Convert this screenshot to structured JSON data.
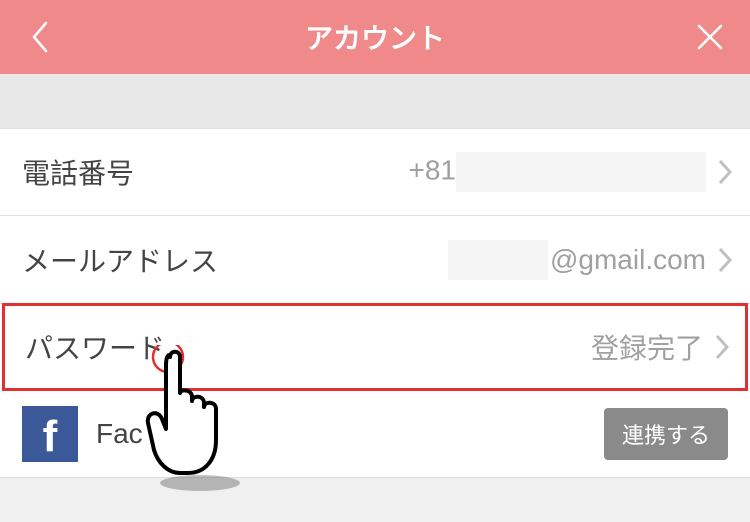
{
  "header": {
    "title": "アカウント"
  },
  "rows": {
    "phone": {
      "label": "電話番号",
      "value": "+81"
    },
    "email": {
      "label": "メールアドレス",
      "value": "@gmail.com"
    },
    "password": {
      "label": "パスワード",
      "value": "登録完了"
    },
    "facebook": {
      "label": "Fac",
      "button": "連携する"
    }
  }
}
